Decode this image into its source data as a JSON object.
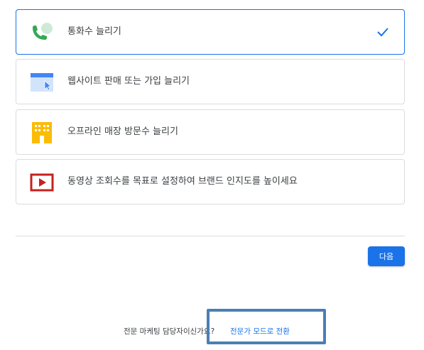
{
  "goals": [
    {
      "label": "통화수 늘리기",
      "icon": "phone-call-icon",
      "selected": true
    },
    {
      "label": "웹사이트 판매 또는 가입 늘리기",
      "icon": "website-cursor-icon",
      "selected": false
    },
    {
      "label": "오프라인 매장 방문수 늘리기",
      "icon": "storefront-icon",
      "selected": false
    },
    {
      "label": "동영상 조회수를 목표로 설정하여 브랜드 인지도를 높이세요",
      "icon": "video-play-icon",
      "selected": false
    }
  ],
  "next_button": {
    "label": "다음"
  },
  "footer": {
    "question": "전문 마케팅 담당자이신가요?",
    "link": "전문가 모드로 전환"
  },
  "colors": {
    "accent": "#1a73e8",
    "border": "#dadce0",
    "highlight_box": "#4a7fb5",
    "phone_green": "#34a853",
    "store_yellow": "#fbbc04",
    "video_red": "#c5221f"
  }
}
